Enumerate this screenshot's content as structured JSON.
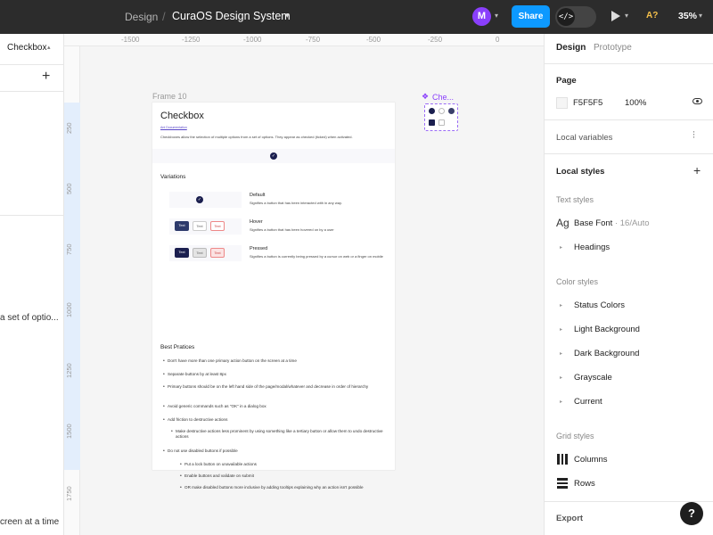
{
  "topbar": {
    "project": "Design",
    "separator": "/",
    "file_name": "CuraOS Design System",
    "avatar_initial": "M",
    "share_label": "Share",
    "devmode_glyph": "</>",
    "a11y_badge": "A?",
    "zoom": "35%"
  },
  "left_panel": {
    "page_label": "Checkbox",
    "add_glyph": "+",
    "layer_text_1": "a set of optio...",
    "layer_text_2": "creen at a time"
  },
  "canvas": {
    "ruler_top": [
      "-1500",
      "-1250",
      "-1000",
      "-750",
      "-500",
      "-250",
      "0"
    ],
    "ruler_left": [
      "250",
      "500",
      "750",
      "1000",
      "1250",
      "1500",
      "1750"
    ],
    "frame_label": "Frame 10",
    "component_label": "Che...",
    "frame": {
      "title": "Checkbox",
      "link": "Ant Documentation",
      "description": "Checkboxes allow the selection of multiple options from a set of options. They appear as checked (ticked) when activated.",
      "variations_heading": "Variations",
      "variations": [
        {
          "label": "Default",
          "desc": "Signifies a button that has been interacted with in any way."
        },
        {
          "label": "Hover",
          "desc": "Signifies a button that has been hovered on by a user"
        },
        {
          "label": "Pressed",
          "desc": "Signifies a button is currently being pressed by a cursor on web or a finger on mobile"
        }
      ],
      "mini_button_text": "Text",
      "best_practices_heading": "Best Pratices",
      "bullets": [
        "Don't have more than one primary action button on the screen at a time",
        "Separate buttons by at least 8px",
        "Primary buttons should be on the left hand side of the page/modal/whatever and decrease in order of hierarchy",
        "Avoid generic commands such as \"OK\" in a dialog box",
        "Add friction to destructive actions",
        "Make destructive actions less prominent by using something like a tertiary button or allow them to undo destructive actions",
        "Do not use disabled buttons if possible",
        "Put a lock button on unavailable actions",
        "Enable buttons and validate on submit",
        "OR make disabled buttons more inclusive by adding tooltips explaining why an action isn't possible"
      ]
    }
  },
  "right_panel": {
    "tabs": [
      "Design",
      "Prototype"
    ],
    "page_section": "Page",
    "page_color": "F5F5F5",
    "page_opacity": "100%",
    "local_variables": "Local variables",
    "local_styles": "Local styles",
    "text_styles_heading": "Text styles",
    "base_font_icon": "Ag",
    "base_font_name": "Base Font",
    "base_font_meta": " · 16/Auto",
    "text_styles": [
      "Headings"
    ],
    "color_styles_heading": "Color styles",
    "color_styles": [
      "Status Colors",
      "Light Background",
      "Dark Background",
      "Grayscale",
      "Current"
    ],
    "grid_styles_heading": "Grid styles",
    "grid_styles": [
      "Columns",
      "Rows"
    ],
    "export_heading": "Export",
    "help_glyph": "?"
  },
  "colors": {
    "accent_blue": "#0d99ff",
    "avatar_purple": "#8a3ffc",
    "checkbox_navy": "#1b1f4f",
    "topbar_dark": "#2c2c2c"
  },
  "icons": [
    "chevron-down-icon",
    "play-icon",
    "eye-icon",
    "sliders-icon",
    "plus-icon",
    "columns-grid-icon",
    "rows-grid-icon",
    "component-icon",
    "help-icon",
    "code-icon"
  ]
}
